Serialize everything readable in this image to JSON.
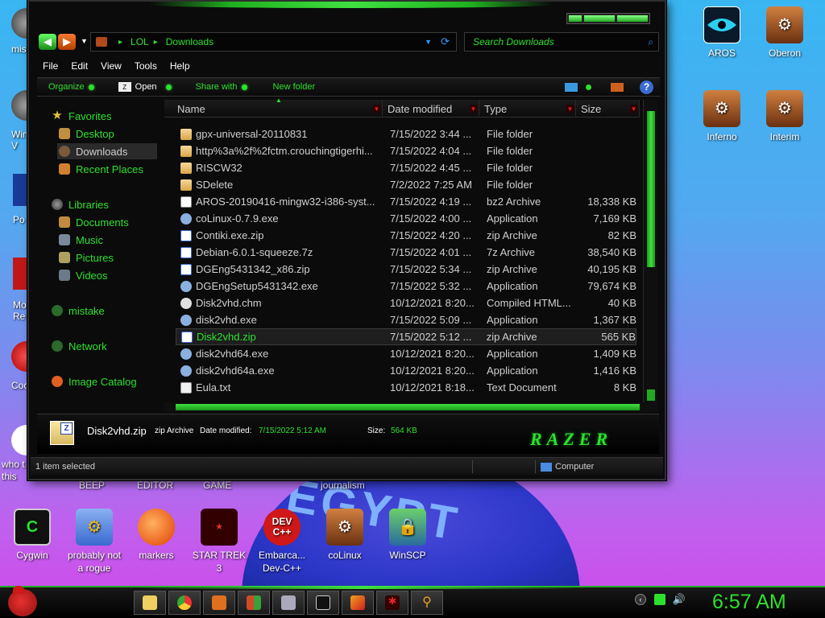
{
  "desktop": {
    "emblem_text": "EGYPT",
    "right_icons": [
      {
        "label": "AROS"
      },
      {
        "label": "Oberon"
      },
      {
        "label": "Inferno"
      },
      {
        "label": "Interim"
      }
    ],
    "left_partial_labels": [
      "mis",
      "Win V",
      "Po",
      "Mo Re",
      "Cock",
      "who t uses this"
    ],
    "behind_window_labels": [
      "BEEP",
      "EDITOR",
      "GAME",
      "journalism"
    ],
    "bottom_icons": [
      {
        "label": "Cygwin"
      },
      {
        "label": "probably not a rogue"
      },
      {
        "label": "markers"
      },
      {
        "label": "STAR TREK 3"
      },
      {
        "label": "Embarca... Dev-C++"
      },
      {
        "label": "coLinux"
      },
      {
        "label": "WinSCP"
      }
    ]
  },
  "explorer": {
    "breadcrumb": [
      "LOL",
      "Downloads"
    ],
    "search_placeholder": "Search Downloads",
    "menu": [
      "File",
      "Edit",
      "View",
      "Tools",
      "Help"
    ],
    "toolbar": {
      "organize": "Organize",
      "open": "Open",
      "share_with": "Share with",
      "new_folder": "New folder"
    },
    "nav": {
      "favorites": "Favorites",
      "desktop": "Desktop",
      "downloads": "Downloads",
      "recent": "Recent Places",
      "libraries": "Libraries",
      "documents": "Documents",
      "music": "Music",
      "pictures": "Pictures",
      "videos": "Videos",
      "mistake": "mistake",
      "network": "Network",
      "image_catalog": "Image Catalog"
    },
    "columns": {
      "name": "Name",
      "date": "Date modified",
      "type": "Type",
      "size": "Size"
    },
    "files": [
      {
        "name": "gpx-universal-20110831",
        "date": "7/15/2022 3:44 ...",
        "type": "File folder",
        "size": "",
        "icon": "folder"
      },
      {
        "name": "http%3a%2f%2fctm.crouchingtigerhi...",
        "date": "7/15/2022 4:04 ...",
        "type": "File folder",
        "size": "",
        "icon": "folder"
      },
      {
        "name": "RISCW32",
        "date": "7/15/2022 4:45 ...",
        "type": "File folder",
        "size": "",
        "icon": "folder"
      },
      {
        "name": "SDelete",
        "date": "7/2/2022 7:25 AM",
        "type": "File folder",
        "size": "",
        "icon": "folder"
      },
      {
        "name": "AROS-20190416-mingw32-i386-syst...",
        "date": "7/15/2022 4:19 ...",
        "type": "bz2 Archive",
        "size": "18,338 KB",
        "icon": "arch"
      },
      {
        "name": "coLinux-0.7.9.exe",
        "date": "7/15/2022 4:00 ...",
        "type": "Application",
        "size": "7,169 KB",
        "icon": "app"
      },
      {
        "name": "Contiki.exe.zip",
        "date": "7/15/2022 4:20 ...",
        "type": "zip Archive",
        "size": "82 KB",
        "icon": "zip"
      },
      {
        "name": "Debian-6.0.1-squeeze.7z",
        "date": "7/15/2022 4:01 ...",
        "type": "7z Archive",
        "size": "38,540 KB",
        "icon": "zip"
      },
      {
        "name": "DGEng5431342_x86.zip",
        "date": "7/15/2022 5:34 ...",
        "type": "zip Archive",
        "size": "40,195 KB",
        "icon": "zip"
      },
      {
        "name": "DGEngSetup5431342.exe",
        "date": "7/15/2022 5:32 ...",
        "type": "Application",
        "size": "79,674 KB",
        "icon": "app"
      },
      {
        "name": "Disk2vhd.chm",
        "date": "10/12/2021 8:20...",
        "type": "Compiled HTML...",
        "size": "40 KB",
        "icon": "help"
      },
      {
        "name": "disk2vhd.exe",
        "date": "7/15/2022 5:09 ...",
        "type": "Application",
        "size": "1,367 KB",
        "icon": "app"
      },
      {
        "name": "Disk2vhd.zip",
        "date": "7/15/2022 5:12 ...",
        "type": "zip Archive",
        "size": "565 KB",
        "icon": "zip",
        "selected": true
      },
      {
        "name": "disk2vhd64.exe",
        "date": "10/12/2021 8:20...",
        "type": "Application",
        "size": "1,409 KB",
        "icon": "app"
      },
      {
        "name": "disk2vhd64a.exe",
        "date": "10/12/2021 8:20...",
        "type": "Application",
        "size": "1,416 KB",
        "icon": "app"
      },
      {
        "name": "Eula.txt",
        "date": "10/12/2021 8:18...",
        "type": "Text Document",
        "size": "8 KB",
        "icon": "txt"
      }
    ],
    "details": {
      "name": "Disk2vhd.zip",
      "type": "zip Archive",
      "modified_label": "Date modified:",
      "modified_value": "7/15/2022 5:12 AM",
      "size_label": "Size:",
      "size_value": "564 KB",
      "brand": "RAZER"
    },
    "status": {
      "selection": "1 item selected",
      "location": "Computer"
    }
  },
  "taskbar": {
    "clock": "6:57 AM",
    "buttons": [
      "explorer",
      "chrome",
      "gimp",
      "app",
      "remote-desktop",
      "cmd",
      "paint",
      "razer",
      "search"
    ]
  }
}
